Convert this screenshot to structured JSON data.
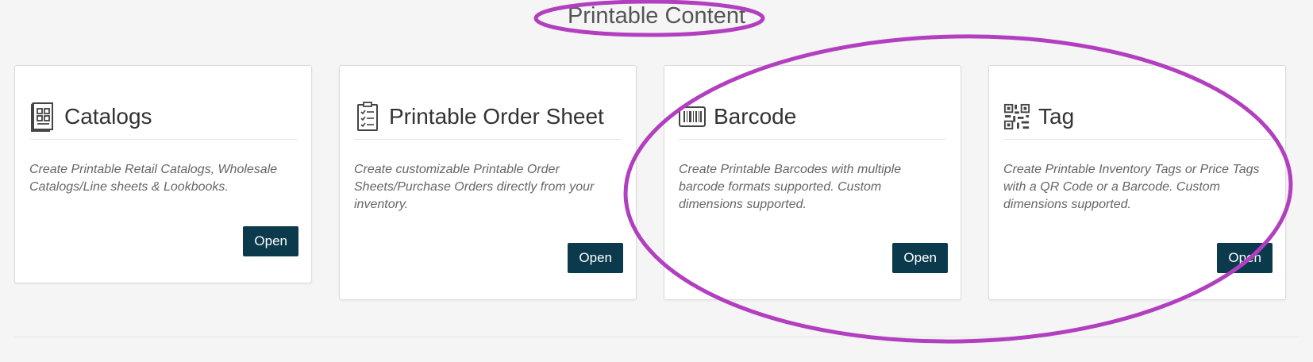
{
  "section": {
    "title": "Printable Content"
  },
  "cards": [
    {
      "title": "Catalogs",
      "icon": "catalog-icon",
      "description": "Create Printable Retail Catalogs, Wholesale Catalogs/Line sheets & Lookbooks.",
      "button_label": "Open"
    },
    {
      "title": "Printable Order Sheet",
      "icon": "order-sheet-icon",
      "description": "Create customizable Printable Order Sheets/Purchase Orders directly from your inventory.",
      "button_label": "Open"
    },
    {
      "title": "Barcode",
      "icon": "barcode-icon",
      "description": "Create Printable Barcodes with multiple barcode formats supported. Custom dimensions supported.",
      "button_label": "Open"
    },
    {
      "title": "Tag",
      "icon": "qr-code-icon",
      "description": "Create Printable Inventory Tags or Price Tags with a QR Code or a Barcode. Custom dimensions supported.",
      "button_label": "Open"
    }
  ],
  "colors": {
    "button": "#0b3a4d",
    "annotation": "#b23fbf"
  }
}
